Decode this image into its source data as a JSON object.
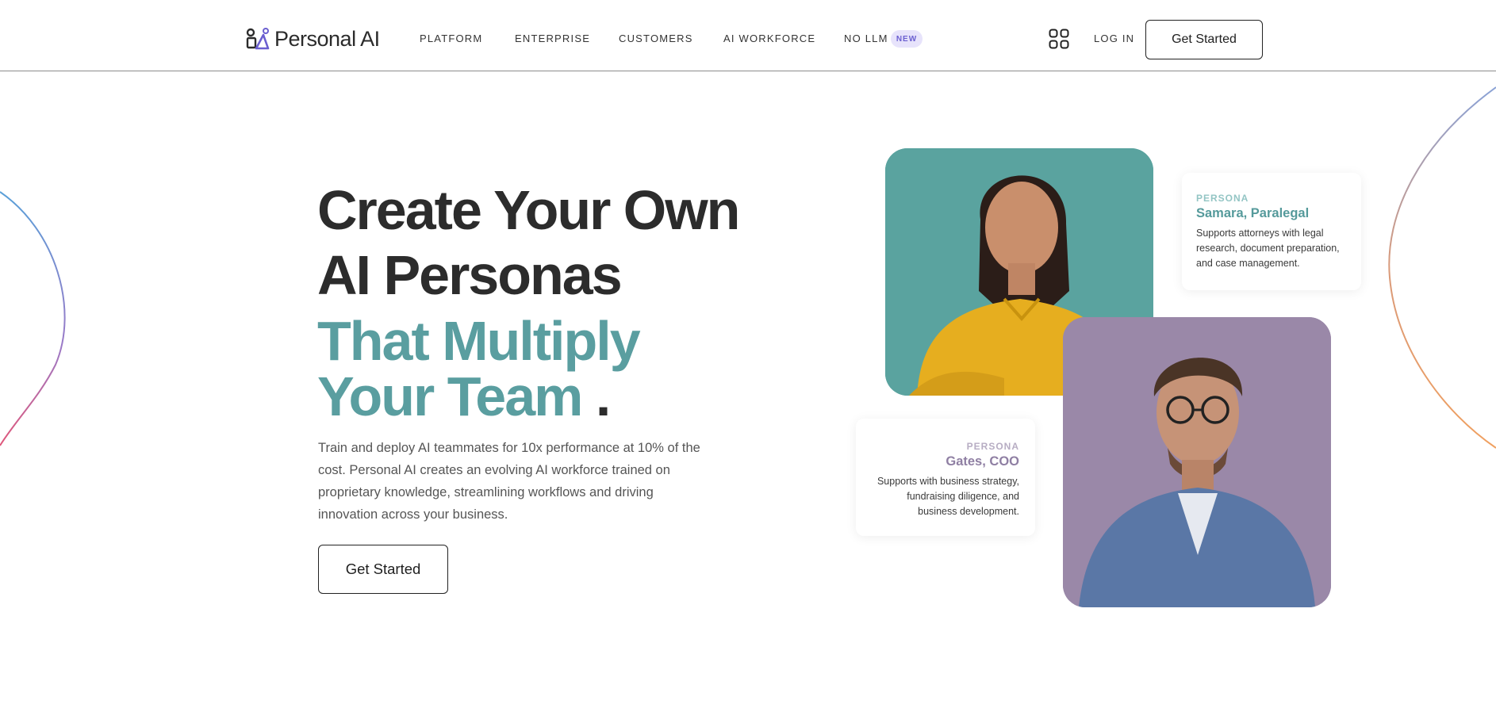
{
  "brand": {
    "name": "Personal AI"
  },
  "nav": {
    "items": [
      "PLATFORM",
      "ENTERPRISE",
      "CUSTOMERS",
      "AI WORKFORCE",
      "NO LLM"
    ],
    "badge": "NEW",
    "login": "LOG IN",
    "cta": "Get Started"
  },
  "hero": {
    "title_line_1": "Create Your Own",
    "title_line_2": "AI Personas",
    "title_line_3": "That Multiply",
    "title_line_4": "Your Team",
    "title_period": ".",
    "description": "Train and deploy AI teammates for 10x performance at 10% of the cost. Personal AI creates an evolving AI workforce trained on proprietary knowledge, streamlining workflows and driving innovation across your business.",
    "cta": "Get Started"
  },
  "personas": [
    {
      "tag": "PERSONA",
      "name": "Samara, Paralegal",
      "description": "Supports attorneys with legal research, document preparation, and case management."
    },
    {
      "tag": "PERSONA",
      "name": "Gates, COO",
      "description": "Supports with business strategy, fundraising diligence, and business development."
    }
  ],
  "colors": {
    "accent_teal": "#5a9ea0",
    "accent_purple": "#8f7fa3",
    "badge_bg": "#e7e3fb",
    "badge_text": "#6b5fd0",
    "photo_1_bg": "#5aa39f",
    "photo_2_bg": "#9a88a8"
  },
  "icons": [
    "personal-ai-logo-icon",
    "apps-grid-icon"
  ]
}
